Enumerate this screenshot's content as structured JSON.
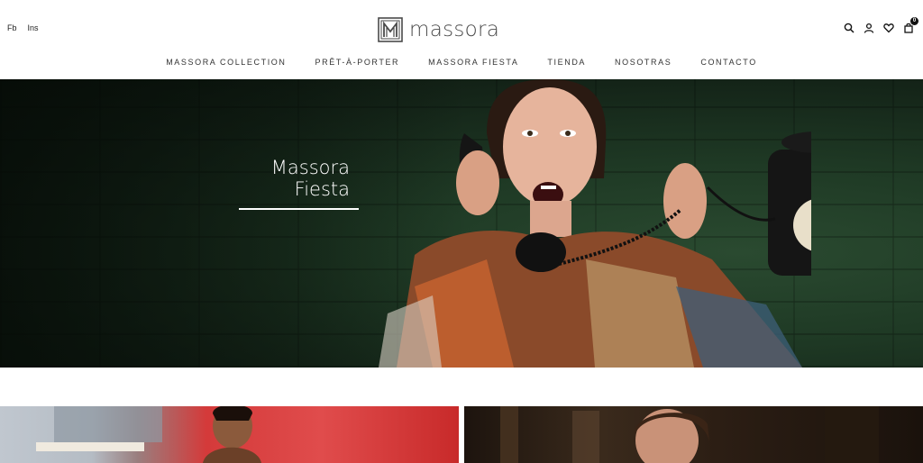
{
  "header": {
    "social": [
      {
        "label": "Fb"
      },
      {
        "label": "Ins"
      }
    ],
    "logo": {
      "text": "massora"
    },
    "icons": [
      "search-icon",
      "user-icon",
      "heart-icon",
      "cart-icon"
    ],
    "cart_count": "0"
  },
  "nav": {
    "items": [
      {
        "label": "MASSORA COLLECTION"
      },
      {
        "label": "PRÊT-À-PORTER"
      },
      {
        "label": "MASSORA FIESTA"
      },
      {
        "label": "TIENDA"
      },
      {
        "label": "NOSOTRAS"
      },
      {
        "label": "CONTACTO"
      }
    ]
  },
  "hero": {
    "title_line1": "Massora",
    "title_line2": "Fiesta"
  },
  "colors": {
    "hero_bg": "#1f3a25",
    "text": "#333333",
    "accent_red": "#d43a3a"
  }
}
